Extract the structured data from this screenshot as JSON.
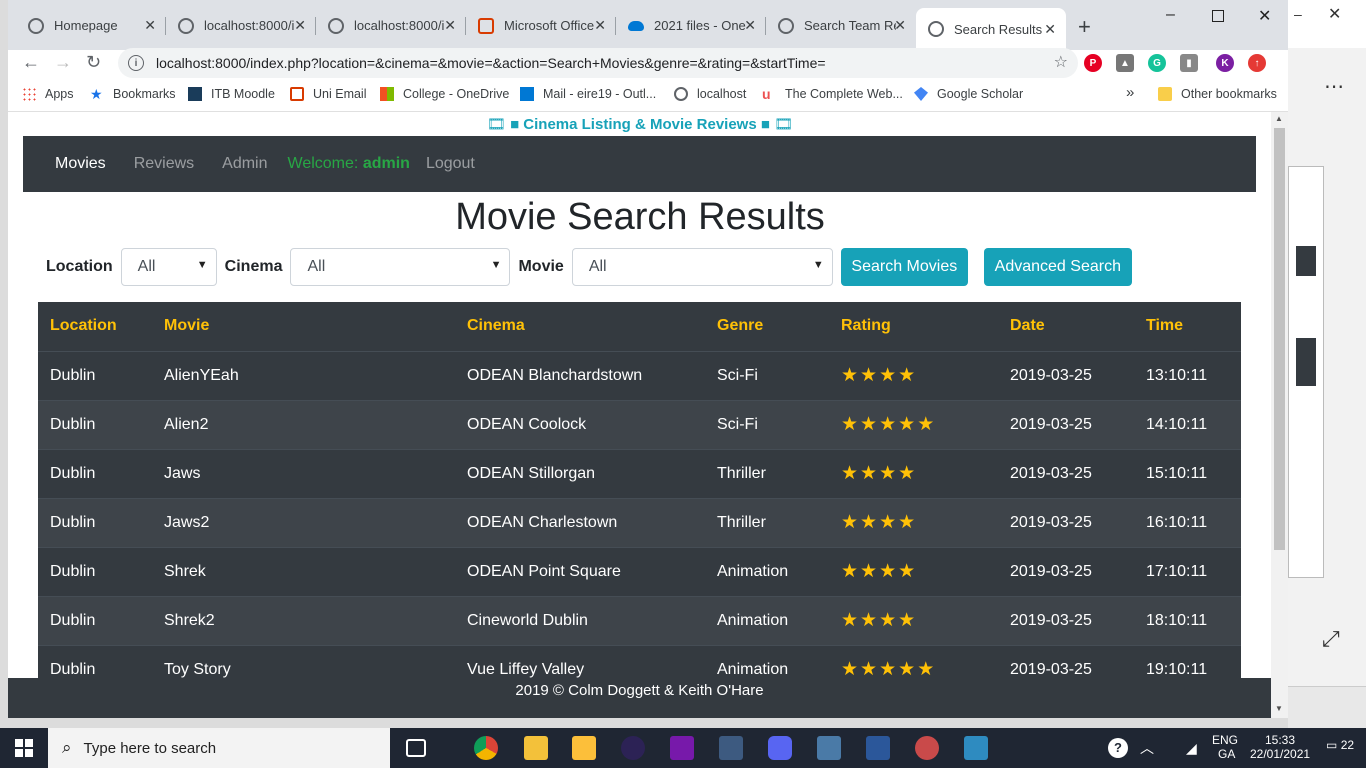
{
  "browser": {
    "tabs": [
      {
        "title": "Homepage",
        "active": false
      },
      {
        "title": "localhost:8000/i",
        "active": false
      },
      {
        "title": "localhost:8000/i",
        "active": false
      },
      {
        "title": "Microsoft Office",
        "active": false
      },
      {
        "title": "2021 files - One",
        "active": false
      },
      {
        "title": "Search Team Re",
        "active": false
      },
      {
        "title": "Search Results",
        "active": true
      }
    ],
    "url": "localhost:8000/index.php?location=&cinema=&movie=&action=Search+Movies&genre=&rating=&startTime=",
    "bookmarks": [
      "Apps",
      "Bookmarks",
      "ITB Moodle",
      "Uni Email",
      "College - OneDrive",
      "Mail - eire19 - Outl...",
      "localhost",
      "The Complete Web...",
      "Google Scholar"
    ],
    "other_bookmarks": "Other bookmarks",
    "more_bookmarks": "»",
    "profile_initial": "K"
  },
  "page": {
    "site_title": "Cinema Listing & Movie Reviews",
    "nav": {
      "movies": "Movies",
      "reviews": "Reviews",
      "admin": "Admin",
      "welcome_prefix": "Welcome:",
      "welcome_user": "admin",
      "logout": "Logout"
    },
    "heading": "Movie Search Results",
    "filters": {
      "location_label": "Location",
      "location_value": "All",
      "cinema_label": "Cinema",
      "cinema_value": "All",
      "movie_label": "Movie",
      "movie_value": "All",
      "search_button": "Search Movies",
      "advanced_button": "Advanced Search"
    },
    "table": {
      "headers": [
        "Location",
        "Movie",
        "Cinema",
        "Genre",
        "Rating",
        "Date",
        "Time"
      ],
      "rows": [
        {
          "location": "Dublin",
          "movie": "AlienYEah",
          "cinema": "ODEAN Blanchardstown",
          "genre": "Sci-Fi",
          "rating": 4,
          "date": "2019-03-25",
          "time": "13:10:11"
        },
        {
          "location": "Dublin",
          "movie": "Alien2",
          "cinema": "ODEAN Coolock",
          "genre": "Sci-Fi",
          "rating": 5,
          "date": "2019-03-25",
          "time": "14:10:11"
        },
        {
          "location": "Dublin",
          "movie": "Jaws",
          "cinema": "ODEAN Stillorgan",
          "genre": "Thriller",
          "rating": 4,
          "date": "2019-03-25",
          "time": "15:10:11"
        },
        {
          "location": "Dublin",
          "movie": "Jaws2",
          "cinema": "ODEAN Charlestown",
          "genre": "Thriller",
          "rating": 4,
          "date": "2019-03-25",
          "time": "16:10:11"
        },
        {
          "location": "Dublin",
          "movie": "Shrek",
          "cinema": "ODEAN Point Square",
          "genre": "Animation",
          "rating": 4,
          "date": "2019-03-25",
          "time": "17:10:11"
        },
        {
          "location": "Dublin",
          "movie": "Shrek2",
          "cinema": "Cineworld Dublin",
          "genre": "Animation",
          "rating": 4,
          "date": "2019-03-25",
          "time": "18:10:11"
        },
        {
          "location": "Dublin",
          "movie": "Toy Story",
          "cinema": "Vue Liffey Valley",
          "genre": "Animation",
          "rating": 5,
          "date": "2019-03-25",
          "time": "19:10:11"
        }
      ]
    },
    "footer": "2019 © Colm Doggett & Keith O'Hare"
  },
  "taskbar": {
    "search_placeholder": "Type here to search",
    "lang_top": "ENG",
    "lang_bottom": "GA",
    "time": "15:33",
    "date": "22/01/2021",
    "notifications": "22"
  },
  "colors": {
    "accent": "#17a2b8",
    "navbar": "#343a40",
    "header_text": "#ffc107",
    "welcome": "#28a745"
  }
}
